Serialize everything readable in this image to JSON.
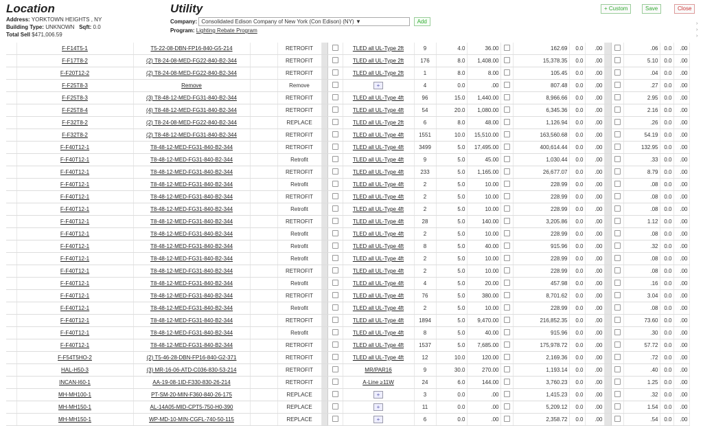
{
  "location": {
    "title": "Location",
    "address_label": "Address:",
    "address": "YORKTOWN HEIGHTS , NY",
    "building_type_label": "Building Type:",
    "building_type": "UNKNOWN",
    "sqft_label": "Sqft:",
    "sqft": "0.0",
    "total_sell_label": "Total Sell",
    "total_sell": "$471,006.59"
  },
  "utility": {
    "title": "Utility",
    "company_label": "Company:",
    "company_value": "Consolidated Edison Company of New York (Con Edison) (NY)",
    "add_label": "Add",
    "program_label": "Program:",
    "program_value": "Lighting Rebate Program"
  },
  "toolbar": {
    "custom_label": "+ Custom",
    "save_label": "Save",
    "close_label": "Close"
  },
  "rows": [
    [
      "F-F14T5-1",
      "T5-22-08-DBN-FP16-840-G5-214",
      "RETROFIT",
      "TLED all UL-Type 2ft",
      "9",
      "4.0",
      "36.00",
      "162.69",
      "0.0",
      ".00",
      ".06",
      "0.0",
      ".00"
    ],
    [
      "F-F17T8-2",
      "(2) T8-24-08-MED-FG22-840-B2-344",
      "RETROFIT",
      "TLED all UL-Type 2ft",
      "176",
      "8.0",
      "1,408.00",
      "15,378.35",
      "0.0",
      ".00",
      "5.10",
      "0.0",
      ".00"
    ],
    [
      "F-F20T12-2",
      "(2) T8-24-08-MED-FG22-840-B2-344",
      "RETROFIT",
      "TLED all UL-Type 2ft",
      "1",
      "8.0",
      "8.00",
      "105.45",
      "0.0",
      ".00",
      ".04",
      "0.0",
      ".00"
    ],
    [
      "F-F25T8-3",
      "Remove",
      "Remove",
      "+",
      "4",
      "0.0",
      ".00",
      "807.48",
      "0.0",
      ".00",
      ".27",
      "0.0",
      ".00"
    ],
    [
      "F-F25T8-3",
      "(3) T8-48-12-MED-FG31-840-B2-344",
      "RETROFIT",
      "TLED all UL-Type 4ft",
      "96",
      "15.0",
      "1,440.00",
      "8,966.66",
      "0.0",
      ".00",
      "2.95",
      "0.0",
      ".00"
    ],
    [
      "F-F25T8-4",
      "(4) T8-48-12-MED-FG31-840-B2-344",
      "RETROFIT",
      "TLED all UL-Type 4ft",
      "54",
      "20.0",
      "1,080.00",
      "6,345.36",
      "0.0",
      ".00",
      "2.16",
      "0.0",
      ".00"
    ],
    [
      "F-F32T8-2",
      "(2) T8-24-08-MED-FG22-840-B2-344",
      "REPLACE",
      "TLED all UL-Type 2ft",
      "6",
      "8.0",
      "48.00",
      "1,126.94",
      "0.0",
      ".00",
      ".26",
      "0.0",
      ".00"
    ],
    [
      "F-F32T8-2",
      "(2) T8-48-12-MED-FG31-840-B2-344",
      "RETROFIT",
      "TLED all UL-Type 4ft",
      "1551",
      "10.0",
      "15,510.00",
      "163,560.68",
      "0.0",
      ".00",
      "54.19",
      "0.0",
      ".00"
    ],
    [
      "F-F40T12-1",
      "T8-48-12-MED-FG31-840-B2-344",
      "RETROFIT",
      "TLED all UL-Type 4ft",
      "3499",
      "5.0",
      "17,495.00",
      "400,614.44",
      "0.0",
      ".00",
      "132.95",
      "0.0",
      ".00"
    ],
    [
      "F-F40T12-1",
      "T8-48-12-MED-FG31-840-B2-344",
      "Retrofit",
      "TLED all UL-Type 4ft",
      "9",
      "5.0",
      "45.00",
      "1,030.44",
      "0.0",
      ".00",
      ".33",
      "0.0",
      ".00"
    ],
    [
      "F-F40T12-1",
      "T8-48-12-MED-FG31-840-B2-344",
      "RETROFIT",
      "TLED all UL-Type 4ft",
      "233",
      "5.0",
      "1,165.00",
      "26,677.07",
      "0.0",
      ".00",
      "8.79",
      "0.0",
      ".00"
    ],
    [
      "F-F40T12-1",
      "T8-48-12-MED-FG31-840-B2-344",
      "Retrofit",
      "TLED all UL-Type 4ft",
      "2",
      "5.0",
      "10.00",
      "228.99",
      "0.0",
      ".00",
      ".08",
      "0.0",
      ".00"
    ],
    [
      "F-F40T12-1",
      "T8-48-12-MED-FG31-840-B2-344",
      "RETROFIT",
      "TLED all UL-Type 4ft",
      "2",
      "5.0",
      "10.00",
      "228.99",
      "0.0",
      ".00",
      ".08",
      "0.0",
      ".00"
    ],
    [
      "F-F40T12-1",
      "T8-48-12-MED-FG31-840-B2-344",
      "Retrofit",
      "TLED all UL-Type 4ft",
      "2",
      "5.0",
      "10.00",
      "228.99",
      "0.0",
      ".00",
      ".08",
      "0.0",
      ".00"
    ],
    [
      "F-F40T12-1",
      "T8-48-12-MED-FG31-840-B2-344",
      "RETROFIT",
      "TLED all UL-Type 4ft",
      "28",
      "5.0",
      "140.00",
      "3,205.86",
      "0.0",
      ".00",
      "1.12",
      "0.0",
      ".00"
    ],
    [
      "F-F40T12-1",
      "T8-48-12-MED-FG31-840-B2-344",
      "Retrofit",
      "TLED all UL-Type 4ft",
      "2",
      "5.0",
      "10.00",
      "228.99",
      "0.0",
      ".00",
      ".08",
      "0.0",
      ".00"
    ],
    [
      "F-F40T12-1",
      "T8-48-12-MED-FG31-840-B2-344",
      "Retrofit",
      "TLED all UL-Type 4ft",
      "8",
      "5.0",
      "40.00",
      "915.96",
      "0.0",
      ".00",
      ".32",
      "0.0",
      ".00"
    ],
    [
      "F-F40T12-1",
      "T8-48-12-MED-FG31-840-B2-344",
      "Retrofit",
      "TLED all UL-Type 4ft",
      "2",
      "5.0",
      "10.00",
      "228.99",
      "0.0",
      ".00",
      ".08",
      "0.0",
      ".00"
    ],
    [
      "F-F40T12-1",
      "T8-48-12-MED-FG31-840-B2-344",
      "RETROFIT",
      "TLED all UL-Type 4ft",
      "2",
      "5.0",
      "10.00",
      "228.99",
      "0.0",
      ".00",
      ".08",
      "0.0",
      ".00"
    ],
    [
      "F-F40T12-1",
      "T8-48-12-MED-FG31-840-B2-344",
      "Retrofit",
      "TLED all UL-Type 4ft",
      "4",
      "5.0",
      "20.00",
      "457.98",
      "0.0",
      ".00",
      ".16",
      "0.0",
      ".00"
    ],
    [
      "F-F40T12-1",
      "T8-48-12-MED-FG31-840-B2-344",
      "RETROFIT",
      "TLED all UL-Type 4ft",
      "76",
      "5.0",
      "380.00",
      "8,701.62",
      "0.0",
      ".00",
      "3.04",
      "0.0",
      ".00"
    ],
    [
      "F-F40T12-1",
      "T8-48-12-MED-FG31-840-B2-344",
      "Retrofit",
      "TLED all UL-Type 4ft",
      "2",
      "5.0",
      "10.00",
      "228.99",
      "0.0",
      ".00",
      ".08",
      "0.0",
      ".00"
    ],
    [
      "F-F40T12-1",
      "T8-48-12-MED-FG31-840-B2-344",
      "RETROFIT",
      "TLED all UL-Type 4ft",
      "1894",
      "5.0",
      "9,470.00",
      "216,852.35",
      "0.0",
      ".00",
      "73.60",
      "0.0",
      ".00"
    ],
    [
      "F-F40T12-1",
      "T8-48-12-MED-FG31-840-B2-344",
      "Retrofit",
      "TLED all UL-Type 4ft",
      "8",
      "5.0",
      "40.00",
      "915.96",
      "0.0",
      ".00",
      ".30",
      "0.0",
      ".00"
    ],
    [
      "F-F40T12-1",
      "T8-48-12-MED-FG31-840-B2-344",
      "RETROFIT",
      "TLED all UL-Type 4ft",
      "1537",
      "5.0",
      "7,685.00",
      "175,978.72",
      "0.0",
      ".00",
      "57.72",
      "0.0",
      ".00"
    ],
    [
      "F-F54T5HO-2",
      "(2) T5-46-28-DBN-FP16-840-G2-371",
      "RETROFIT",
      "TLED all UL-Type 4ft",
      "12",
      "10.0",
      "120.00",
      "2,169.36",
      "0.0",
      ".00",
      ".72",
      "0.0",
      ".00"
    ],
    [
      "HAL-H50-3",
      "(3) MR-16-06-ATD-C036-830-53-214",
      "RETROFIT",
      "MR/PAR16",
      "9",
      "30.0",
      "270.00",
      "1,193.14",
      "0.0",
      ".00",
      ".40",
      "0.0",
      ".00"
    ],
    [
      "INCAN-I60-1",
      "AA-19-08-1ID-F330-830-26-214",
      "RETROFIT",
      "A-Line ≥11W",
      "24",
      "6.0",
      "144.00",
      "3,760.23",
      "0.0",
      ".00",
      "1.25",
      "0.0",
      ".00"
    ],
    [
      "MH-MH100-1",
      "PT-SM-20-MIN-F360-840-26-175",
      "REPLACE",
      "+",
      "3",
      "0.0",
      ".00",
      "1,415.23",
      "0.0",
      ".00",
      ".32",
      "0.0",
      ".00"
    ],
    [
      "MH-MH150-1",
      "AL-14A05-MID-CPT5-750-H0-390",
      "REPLACE",
      "+",
      "11",
      "0.0",
      ".00",
      "5,209.12",
      "0.0",
      ".00",
      "1.54",
      "0.0",
      ".00"
    ],
    [
      "MH-MH150-1",
      "WP-MD-10-MIN-CGFL-740-50-115",
      "REPLACE",
      "+",
      "6",
      "0.0",
      ".00",
      "2,358.72",
      "0.0",
      ".00",
      ".54",
      "0.0",
      ".00"
    ]
  ]
}
